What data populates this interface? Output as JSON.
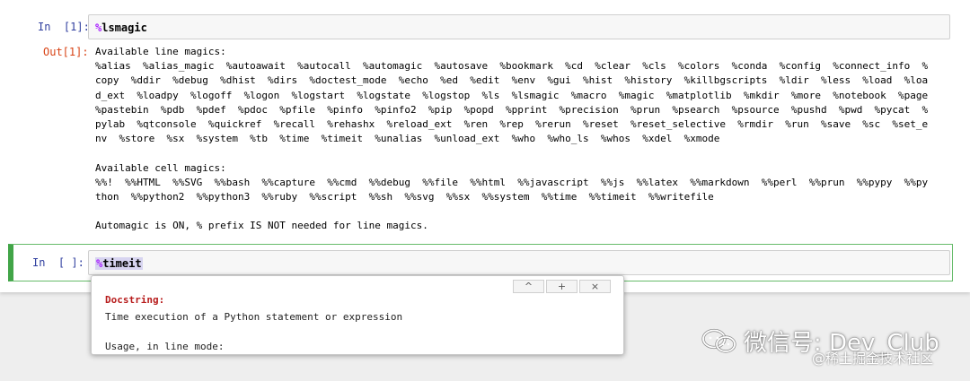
{
  "cell1": {
    "in_prompt": "In  [1]:",
    "code_prefix": "%",
    "code_rest": "lsmagic",
    "out_prompt": "Out[1]:",
    "output_lines": [
      "Available line magics:",
      "%alias  %alias_magic  %autoawait  %autocall  %automagic  %autosave  %bookmark  %cd  %clear  %cls  %colors  %conda  %config  %connect_info  %",
      "copy  %ddir  %debug  %dhist  %dirs  %doctest_mode  %echo  %ed  %edit  %env  %gui  %hist  %history  %killbgscripts  %ldir  %less  %load  %loa",
      "d_ext  %loadpy  %logoff  %logon  %logstart  %logstate  %logstop  %ls  %lsmagic  %macro  %magic  %matplotlib  %mkdir  %more  %notebook  %page",
      "%pastebin  %pdb  %pdef  %pdoc  %pfile  %pinfo  %pinfo2  %pip  %popd  %pprint  %precision  %prun  %psearch  %psource  %pushd  %pwd  %pycat  %",
      "pylab  %qtconsole  %quickref  %recall  %rehashx  %reload_ext  %ren  %rep  %rerun  %reset  %reset_selective  %rmdir  %run  %save  %sc  %set_e",
      "nv  %store  %sx  %system  %tb  %time  %timeit  %unalias  %unload_ext  %who  %who_ls  %whos  %xdel  %xmode",
      "",
      "Available cell magics:",
      "%%!  %%HTML  %%SVG  %%bash  %%capture  %%cmd  %%debug  %%file  %%html  %%javascript  %%js  %%latex  %%markdown  %%perl  %%prun  %%pypy  %%py",
      "thon  %%python2  %%python3  %%ruby  %%script  %%sh  %%svg  %%sx  %%system  %%time  %%timeit  %%writefile",
      "",
      "Automagic is ON, % prefix IS NOT needed for line magics."
    ]
  },
  "cell2": {
    "in_prompt": "In  [ ]:",
    "code_prefix": "%",
    "code_rest": "timeit"
  },
  "tooltip": {
    "btn_up": "^",
    "btn_expand": "+",
    "btn_close": "×",
    "title": "Docstring:",
    "line1": "Time execution of a Python statement or expression",
    "line2": "Usage, in line mode:"
  },
  "watermark": {
    "main": "微信号: Dev_Club",
    "sub": "@稀土掘金技术社区",
    "icon": "wechat-icon"
  },
  "colors": {
    "in_prompt": "#303f9f",
    "out_prompt": "#d84315",
    "magic": "#aa22ff",
    "selected_cell_border": "#42a548",
    "docstring_title": "#b71c1c"
  }
}
